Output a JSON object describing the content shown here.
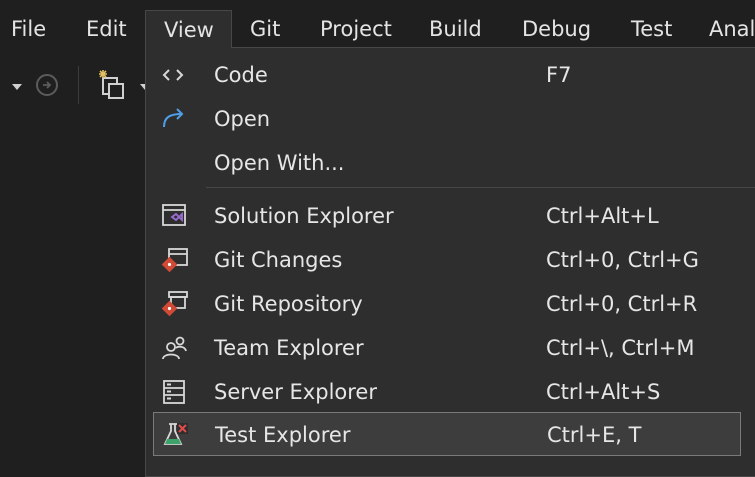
{
  "menubar": {
    "items": [
      "File",
      "Edit",
      "View",
      "Git",
      "Project",
      "Build",
      "Debug",
      "Test",
      "Anal"
    ],
    "active": "View"
  },
  "view_menu": {
    "items": [
      {
        "label": "Code",
        "shortcut": "F7",
        "icon": "code-icon"
      },
      {
        "label": "Open",
        "shortcut": "",
        "icon": "open-icon"
      },
      {
        "label": "Open With...",
        "shortcut": "",
        "icon": ""
      },
      {
        "label": "Solution Explorer",
        "shortcut": "Ctrl+Alt+L",
        "icon": "solution-explorer-icon"
      },
      {
        "label": "Git Changes",
        "shortcut": "Ctrl+0, Ctrl+G",
        "icon": "git-changes-icon"
      },
      {
        "label": "Git Repository",
        "shortcut": "Ctrl+0, Ctrl+R",
        "icon": "git-repository-icon"
      },
      {
        "label": "Team Explorer",
        "shortcut": "Ctrl+\\, Ctrl+M",
        "icon": "team-explorer-icon"
      },
      {
        "label": "Server Explorer",
        "shortcut": "Ctrl+Alt+S",
        "icon": "server-explorer-icon"
      },
      {
        "label": "Test Explorer",
        "shortcut": "Ctrl+E, T",
        "icon": "test-explorer-icon"
      }
    ],
    "selected": "Test Explorer"
  },
  "colors": {
    "background": "#1f1f1f",
    "menu_bg": "#2e2e2e",
    "accent_blue": "#4f9fe8",
    "git_red": "#d04a35",
    "vs_purple": "#9b6cd4"
  }
}
